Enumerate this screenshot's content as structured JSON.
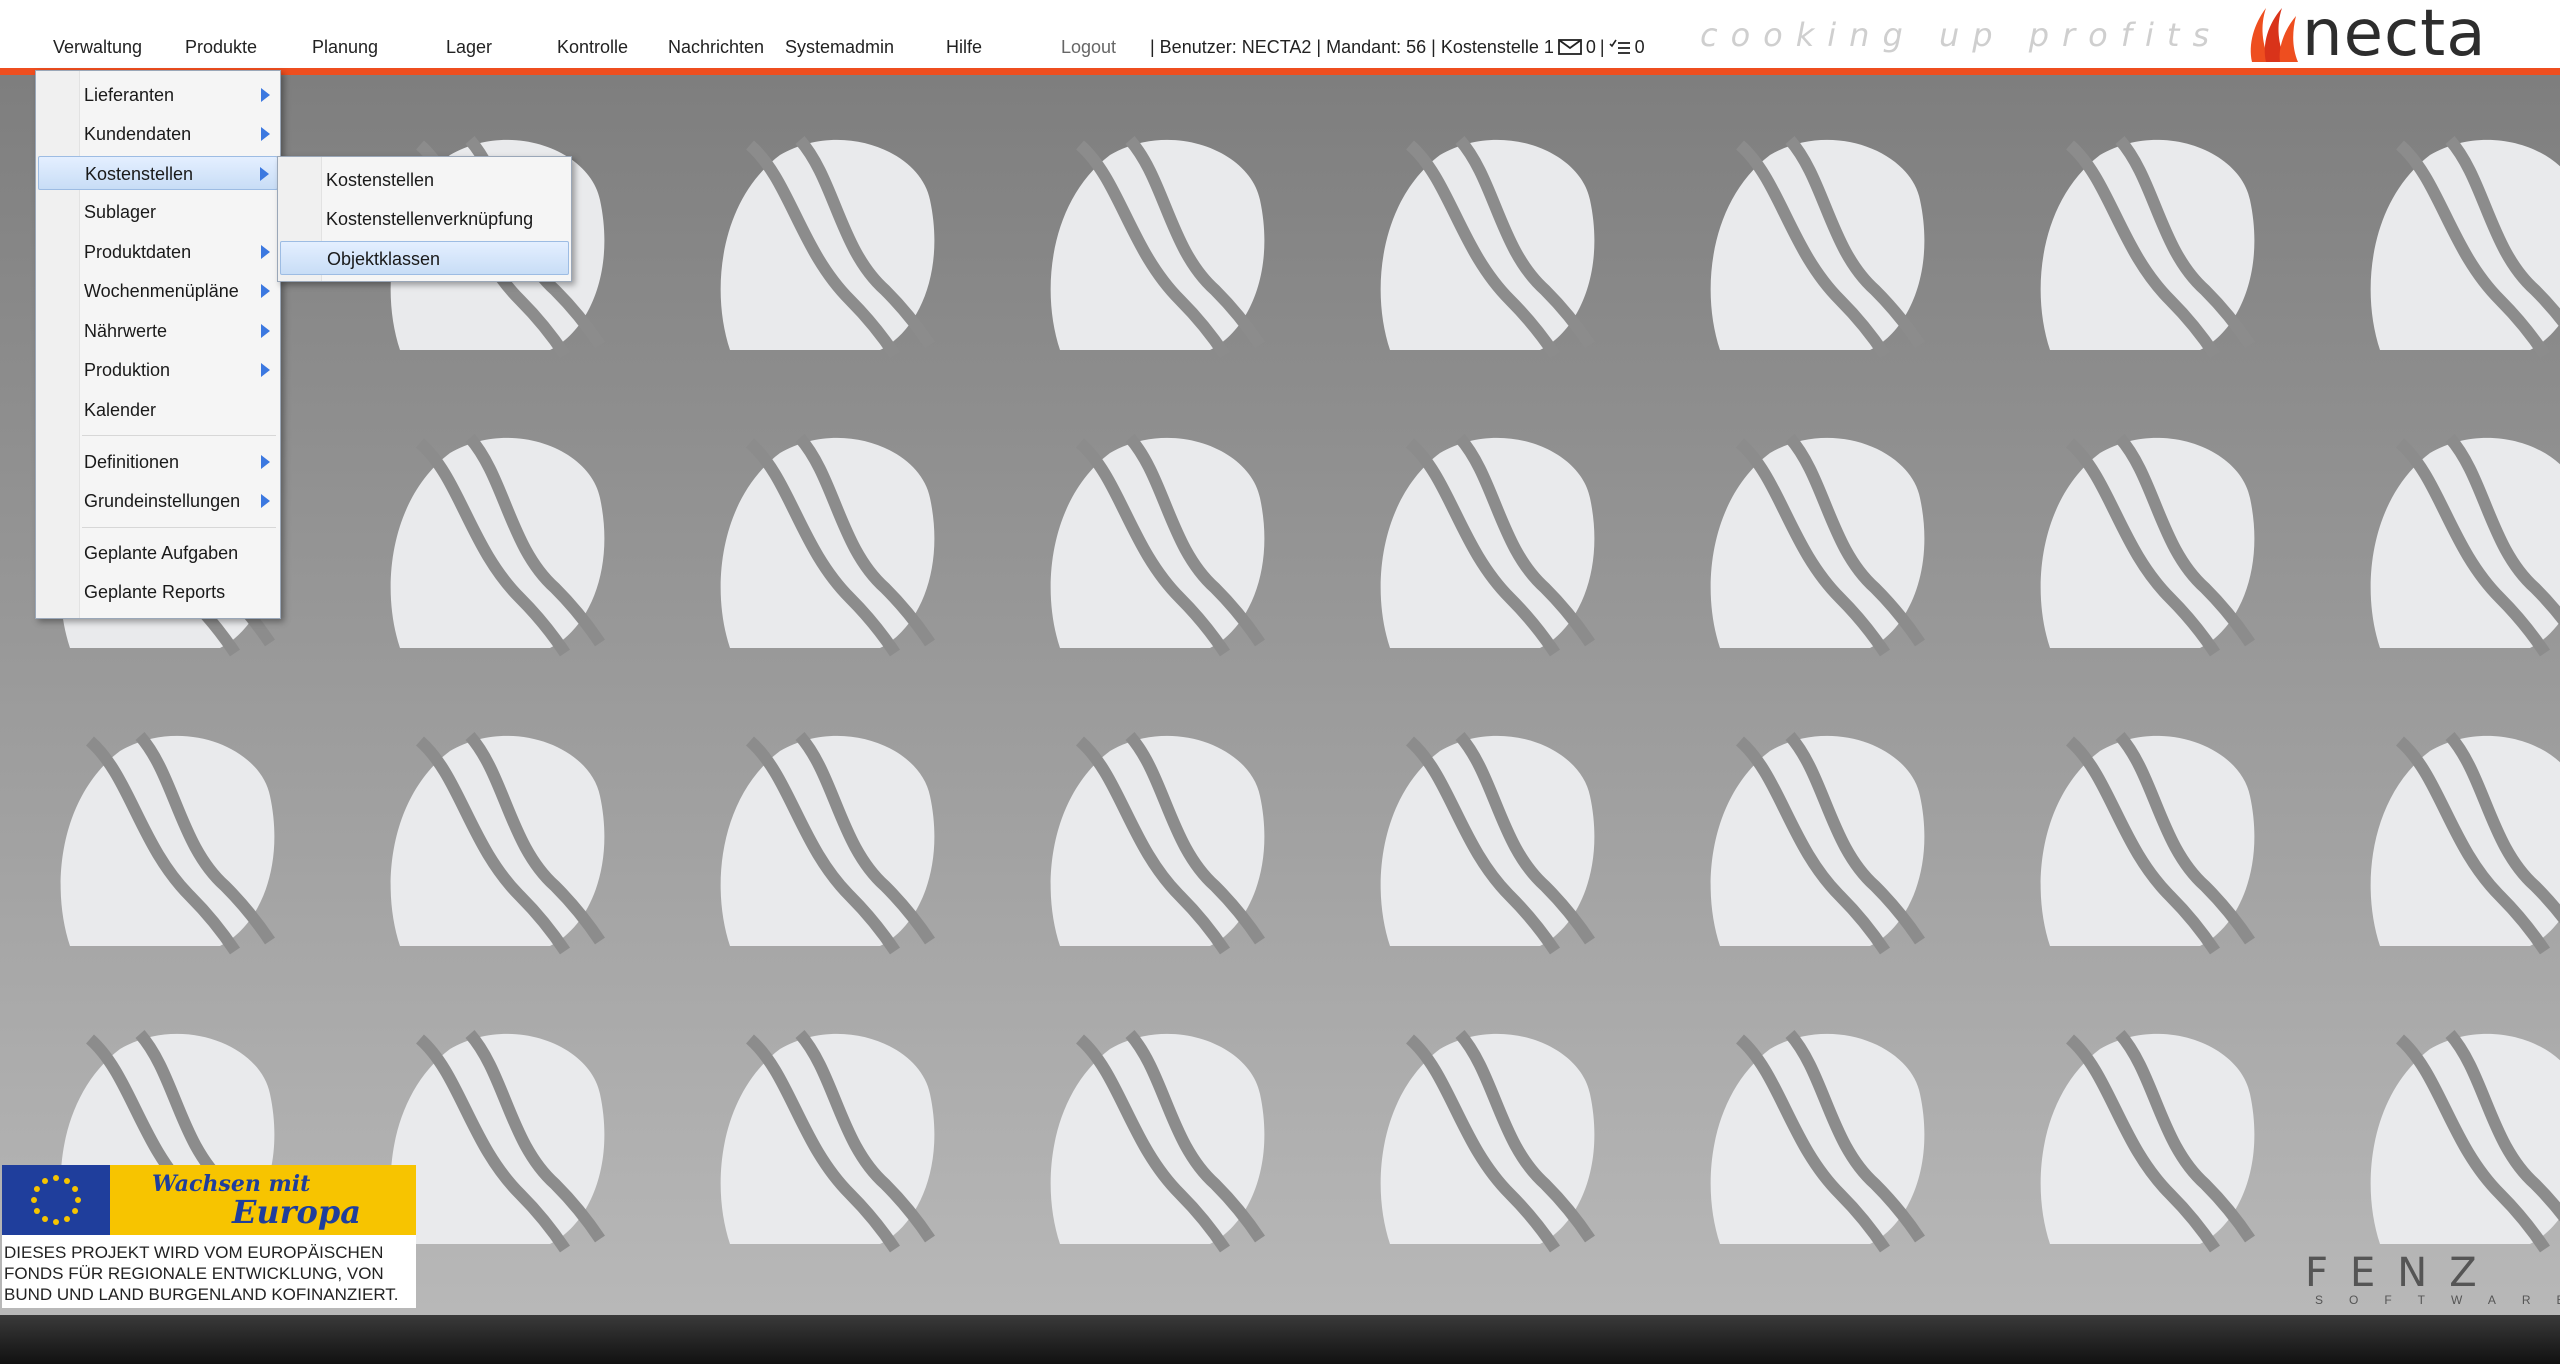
{
  "nav": {
    "items": [
      "Verwaltung",
      "Produkte",
      "Planung",
      "Lager",
      "Kontrolle",
      "Nachrichten",
      "Systemadmin",
      "Hilfe"
    ],
    "logout": "Logout"
  },
  "userinfo": {
    "prefix": "| Benutzer: NECTA2 | Mandant: 56 | Kostenstelle 1",
    "messages_count": "0",
    "separator": "|",
    "tasks_count": "0"
  },
  "branding": {
    "slogan": "cooking up profits",
    "logo": "necta",
    "watermark": "FENZ",
    "watermark_sub": "SOFTWARE"
  },
  "menu": {
    "items": [
      {
        "label": "Lieferanten",
        "has_submenu": true
      },
      {
        "label": "Kundendaten",
        "has_submenu": true
      },
      {
        "label": "Kostenstellen",
        "has_submenu": true,
        "highlighted": true
      },
      {
        "label": "Sublager",
        "has_submenu": false
      },
      {
        "label": "Produktdaten",
        "has_submenu": true
      },
      {
        "label": "Wochenmenüpläne",
        "has_submenu": true
      },
      {
        "label": "Nährwerte",
        "has_submenu": true
      },
      {
        "label": "Produktion",
        "has_submenu": true
      },
      {
        "label": "Kalender",
        "has_submenu": false
      },
      {
        "label": "Definitionen",
        "has_submenu": true
      },
      {
        "label": "Grundeinstellungen",
        "has_submenu": true
      },
      {
        "label": "Geplante Aufgaben",
        "has_submenu": false
      },
      {
        "label": "Geplante Reports",
        "has_submenu": false
      }
    ]
  },
  "submenu": {
    "items": [
      {
        "label": "Kostenstellen"
      },
      {
        "label": "Kostenstellenverknüpfung"
      },
      {
        "label": "Objektklassen",
        "highlighted": true
      }
    ]
  },
  "eu_badge": {
    "title_line1": "Wachsen mit",
    "title_line2": "Europa",
    "text_line1": "DIESES PROJEKT WIRD VOM EUROPÄISCHEN",
    "text_line2": "FONDS FÜR REGIONALE ENTWICKLUNG, VON",
    "text_line3": "BUND UND LAND BURGENLAND KOFINANZIERT."
  },
  "colors": {
    "accent": "#ee4e1f",
    "menu_highlight": "#c8ddf6",
    "submenu_arrow": "#3b78e0"
  }
}
